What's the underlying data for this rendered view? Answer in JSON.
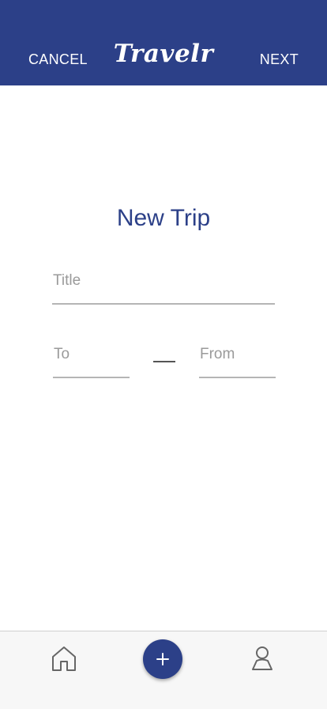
{
  "header": {
    "cancel_label": "CANCEL",
    "logo_text": "Travelr",
    "next_label": "NEXT",
    "background_color": "#2c4088"
  },
  "main": {
    "title": "New Trip",
    "title_placeholder": "Title",
    "to_placeholder": "To",
    "from_placeholder": "From",
    "date_separator": "—"
  },
  "bottom_nav": {
    "items": [
      {
        "icon": "home-icon"
      },
      {
        "icon": "plus-icon"
      },
      {
        "icon": "user-icon"
      }
    ]
  },
  "colors": {
    "brand": "#2c4088",
    "text_muted": "#9a9a9a",
    "underline": "#b5b5b5"
  }
}
